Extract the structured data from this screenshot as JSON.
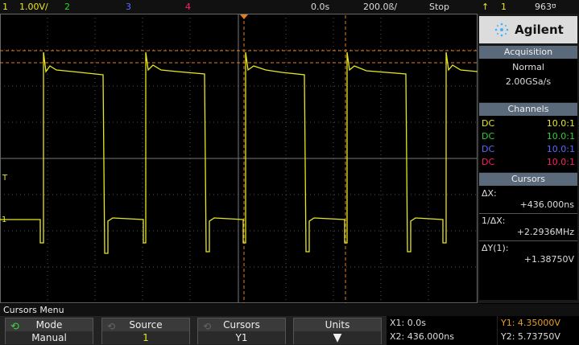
{
  "topbar": {
    "ch1_num": "1",
    "ch1_scale": "1.00V/",
    "ch2_num": "2",
    "ch3_num": "3",
    "ch4_num": "4",
    "time_offset": "0.0s",
    "time_scale": "200.0ß/",
    "status": "Stop",
    "trig_icon": "↑",
    "trig_channel": "1",
    "trig_level": "963",
    "trig_unit_icon": "ʊ"
  },
  "brand": {
    "logo": "Agilent"
  },
  "acquisition": {
    "title": "Acquisition",
    "mode": "Normal",
    "rate": "2.00GSa/s"
  },
  "channels": {
    "title": "Channels",
    "items": [
      {
        "coupling": "DC",
        "probe": "10.0:1",
        "color": "#e8e820"
      },
      {
        "coupling": "DC",
        "probe": "10.0:1",
        "color": "#30d030"
      },
      {
        "coupling": "DC",
        "probe": "10.0:1",
        "color": "#5a6aff"
      },
      {
        "coupling": "DC",
        "probe": "10.0:1",
        "color": "#ff2060"
      }
    ]
  },
  "cursors": {
    "title": "Cursors",
    "dx_label": "ΔX:",
    "dx_value": "+436.000ns",
    "inv_dx_label": "1/ΔX:",
    "inv_dx_value": "+2.2936MHz",
    "dy_label": "ΔY(1):",
    "dy_value": "+1.38750V"
  },
  "menu": {
    "title": "Cursors Menu",
    "softkeys": [
      {
        "label": "Mode",
        "value": "Manual"
      },
      {
        "label": "Source",
        "value": "1"
      },
      {
        "label": "Cursors",
        "value": "Y1"
      },
      {
        "label": "Units",
        "value": ""
      }
    ]
  },
  "readouts": {
    "x1": "X1: 0.0s",
    "x2": "X2: 436.000ns",
    "y1": "Y1: 4.35000V",
    "y2": "Y2: 5.73750V"
  },
  "markers": {
    "trigger_level_marker": "T",
    "ch1_ground_marker": "1"
  },
  "colors": {
    "ch1": "#e8e820",
    "cursor_orange": "#e08020",
    "grid": "#555555",
    "accent": "#3fb0ff"
  }
}
